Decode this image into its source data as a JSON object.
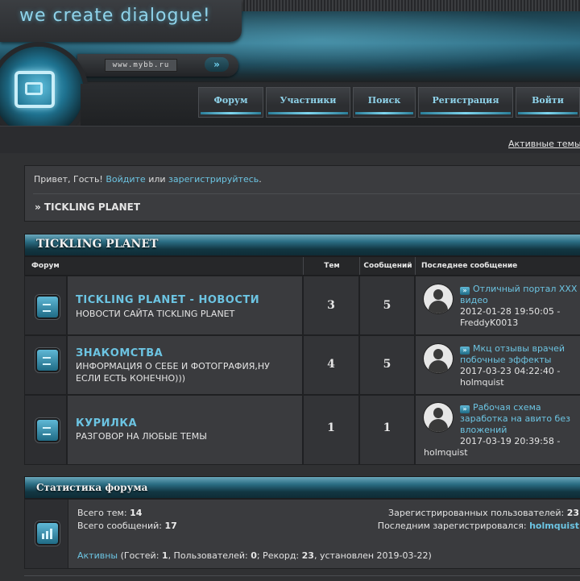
{
  "header": {
    "logo_text": "we create dialogue!",
    "url_text": "www.mybb.ru",
    "go_label": "»",
    "nav": [
      "Форум",
      "Участники",
      "Поиск",
      "Регистрация",
      "Войти"
    ],
    "active_topics": "Активные темы"
  },
  "welcome": {
    "greeting": "Привет, Гость!",
    "login_link": "Войдите",
    "or_text": "или",
    "register_link": "зарегистрируйтесь",
    "period": ".",
    "breadcrumb": "» TICKLING PLANET"
  },
  "category": {
    "title": "TICKLING PLANET",
    "columns": {
      "forum": "Форум",
      "topics": "Тем",
      "posts": "Сообщений",
      "last": "Последнее сообщение"
    },
    "forums": [
      {
        "title": "TICKLING PLANET - НОВОСТИ",
        "description": "НОВОСТИ САЙТА TICKLING PLANET",
        "topics": "3",
        "posts": "5",
        "last_title": "Отличный портал XXX видео",
        "last_date": "2012-01-28 19:50:05 -",
        "last_user": "FreddyK0013"
      },
      {
        "title": "ЗНАКОМСТВА",
        "description": "ИНФОРМАЦИЯ О СЕБЕ И ФОТОГРАФИЯ,НУ ЕСЛИ ЕСТЬ КОНЕЧНО)))",
        "topics": "4",
        "posts": "5",
        "last_title": "Мкц отзывы врачей побочные эффекты",
        "last_date": "2017-03-23 04:22:40 -",
        "last_user": "holmquist"
      },
      {
        "title": "КУРИЛКА",
        "description": "РАЗГОВОР НА ЛЮБЫЕ ТЕМЫ",
        "topics": "1",
        "posts": "1",
        "last_title": "Рабочая схема заработка на авито без вложений",
        "last_date": "2017-03-19 20:39:58 -",
        "last_user": "holmquist"
      }
    ]
  },
  "stats": {
    "title": "Статистика форума",
    "topics_label": "Всего тем:",
    "topics_value": "14",
    "posts_label": "Всего сообщений:",
    "posts_value": "17",
    "registered_label": "Зарегистрированных пользователей:",
    "registered_value": "23",
    "last_registered_label": "Последним зарегистрировался:",
    "last_registered_user": "holmquist",
    "online_link": "Активны",
    "online_pre": "(Гостей:",
    "guests": "1",
    "users_label": ", Пользователей:",
    "users": "0",
    "record_label": "; Рекорд:",
    "record": "23",
    "record_date": ", установлен 2019-03-22)"
  },
  "colors": {
    "accent": "#6cc4e2",
    "background": "#303133",
    "header_teal": "#2a6c82"
  },
  "icons": {
    "logo": "orb-logo-icon",
    "forum": "forum-arrow-icon",
    "avatar": "user-silhouette-icon",
    "stats": "bar-chart-icon"
  }
}
